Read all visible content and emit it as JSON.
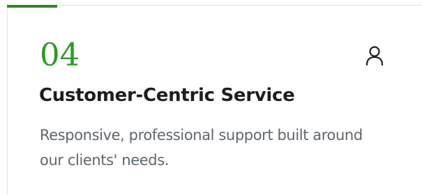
{
  "card": {
    "number": "04",
    "title": "Customer-Centric Service",
    "description": "Responsive, professional support built around our clients' needs.",
    "icon": "user-icon",
    "accent_color": "#2e9a24"
  }
}
